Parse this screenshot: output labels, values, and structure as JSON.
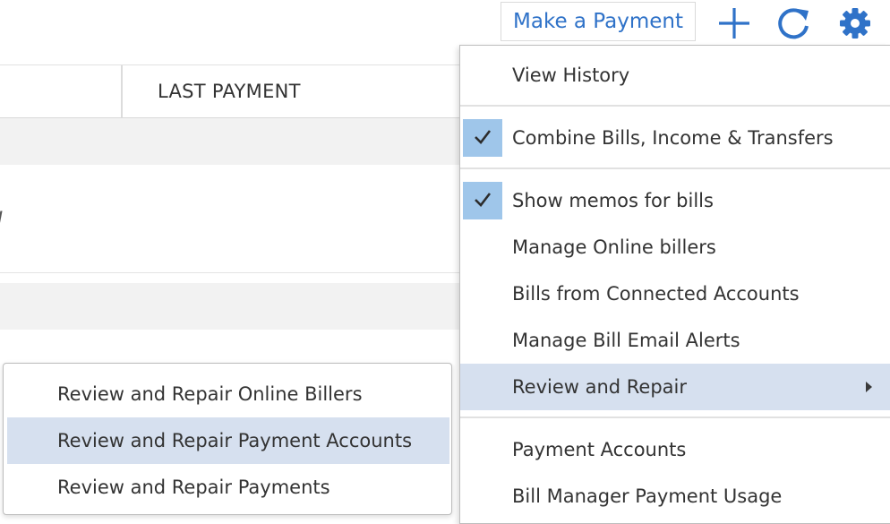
{
  "toolbar": {
    "make_payment_label": "Make a Payment",
    "add_icon": "plus-icon",
    "refresh_icon": "refresh-icon",
    "settings_icon": "gear-icon",
    "accent_color": "#2f72c8"
  },
  "table": {
    "columns": [
      "LAST PAYMENT"
    ],
    "row_fragment": "l"
  },
  "menu": {
    "items": [
      {
        "label": "View History",
        "checked": false,
        "highlighted": false
      },
      {
        "label": "Combine Bills, Income & Transfers",
        "checked": true,
        "highlighted": false
      },
      {
        "label": "Show memos for bills",
        "checked": true,
        "highlighted": false
      },
      {
        "label": "Manage Online billers",
        "checked": false,
        "highlighted": false
      },
      {
        "label": "Bills from Connected Accounts",
        "checked": false,
        "highlighted": false
      },
      {
        "label": "Manage Bill Email Alerts",
        "checked": false,
        "highlighted": false
      },
      {
        "label": "Review and Repair",
        "checked": false,
        "highlighted": true,
        "has_submenu": true
      },
      {
        "label": "Payment Accounts",
        "checked": false,
        "highlighted": false
      },
      {
        "label": "Bill Manager Payment Usage",
        "checked": false,
        "highlighted": false
      }
    ],
    "highlight_color": "#d6e0ef",
    "check_color": "#9fc6ea"
  },
  "submenu": {
    "items": [
      {
        "label": "Review and Repair Online Billers",
        "highlighted": false
      },
      {
        "label": "Review and Repair Payment Accounts",
        "highlighted": true
      },
      {
        "label": "Review and Repair Payments",
        "highlighted": false
      }
    ]
  }
}
